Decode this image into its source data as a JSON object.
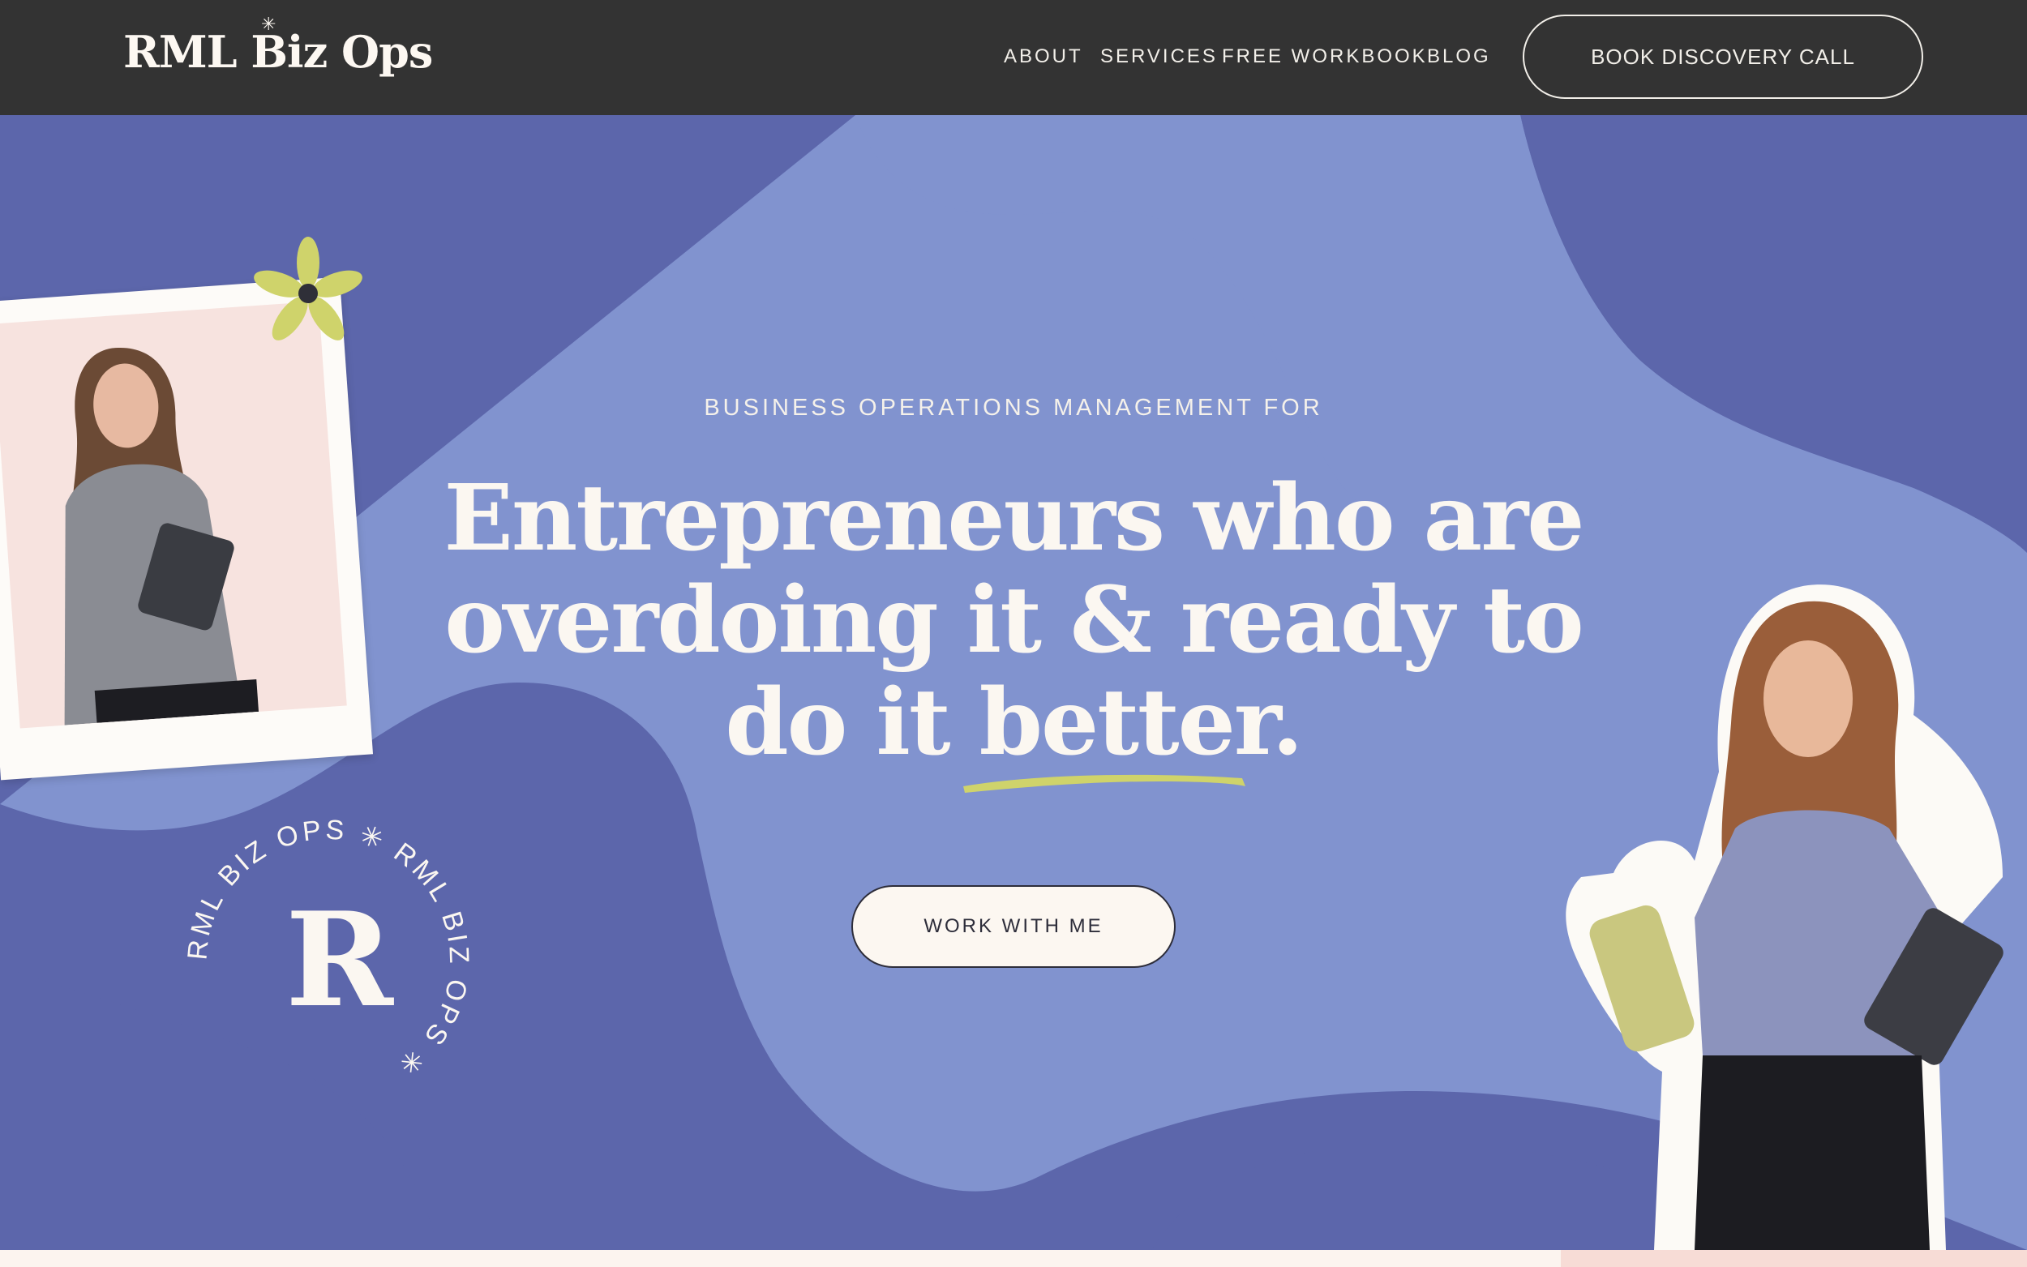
{
  "header": {
    "logo": "RML Biz Ops",
    "nav": [
      "ABOUT",
      "SERVICES",
      "FREE WORKBOOK",
      "BLOG"
    ],
    "cta_label": "BOOK DISCOVERY CALL"
  },
  "hero": {
    "eyebrow": "BUSINESS OPERATIONS MANAGEMENT FOR",
    "headline_lines": [
      "Entrepreneurs who are",
      "overdoing it & ready to",
      "do it better."
    ],
    "cta_label": "WORK WITH ME",
    "seal_letter": "R",
    "seal_text": "RML BIZ OPS ✳ RML BIZ OPS ✳"
  },
  "icons": [
    "flower-icon",
    "asterisk-icon"
  ],
  "colors": {
    "header_bg": "#333333",
    "hero_bg": "#5c66ab",
    "wave": "#8193cf",
    "accent_green": "#cfd36b",
    "cream": "#fcf7f1"
  }
}
